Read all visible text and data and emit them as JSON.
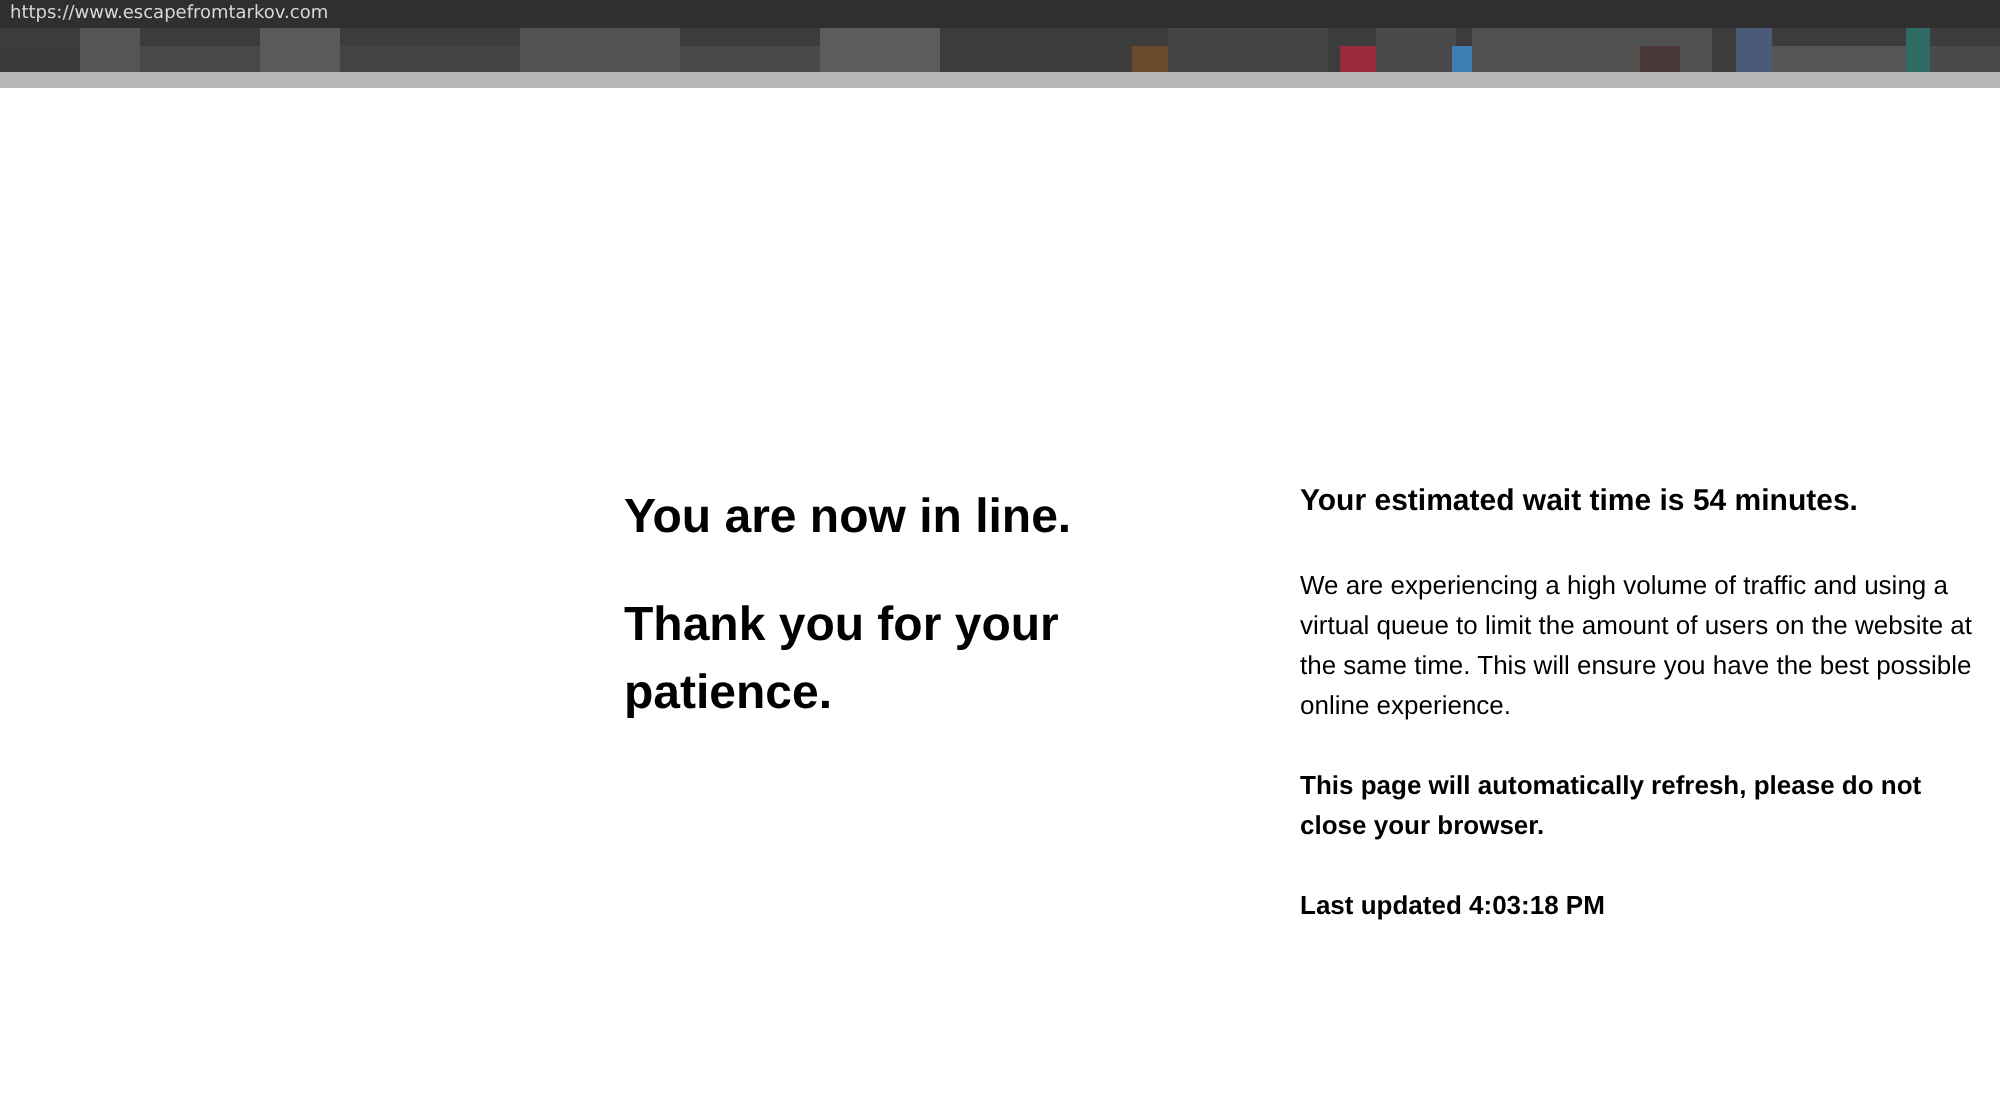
{
  "browser": {
    "url": "https://www.escapefromtarkov.com"
  },
  "left": {
    "headings": [
      "You are now in line.",
      "Thank you for your patience."
    ]
  },
  "right": {
    "wait_heading": "Your estimated wait time is 54 minutes.",
    "message": "We are experiencing a high volume of traffic and using a virtual queue to limit the amount of users on the website at the same time. This will ensure you have the best possible online experience.",
    "refresh_notice": "This page will automatically refresh, please do not close your browser.",
    "last_updated": "Last updated 4:03:18 PM"
  }
}
